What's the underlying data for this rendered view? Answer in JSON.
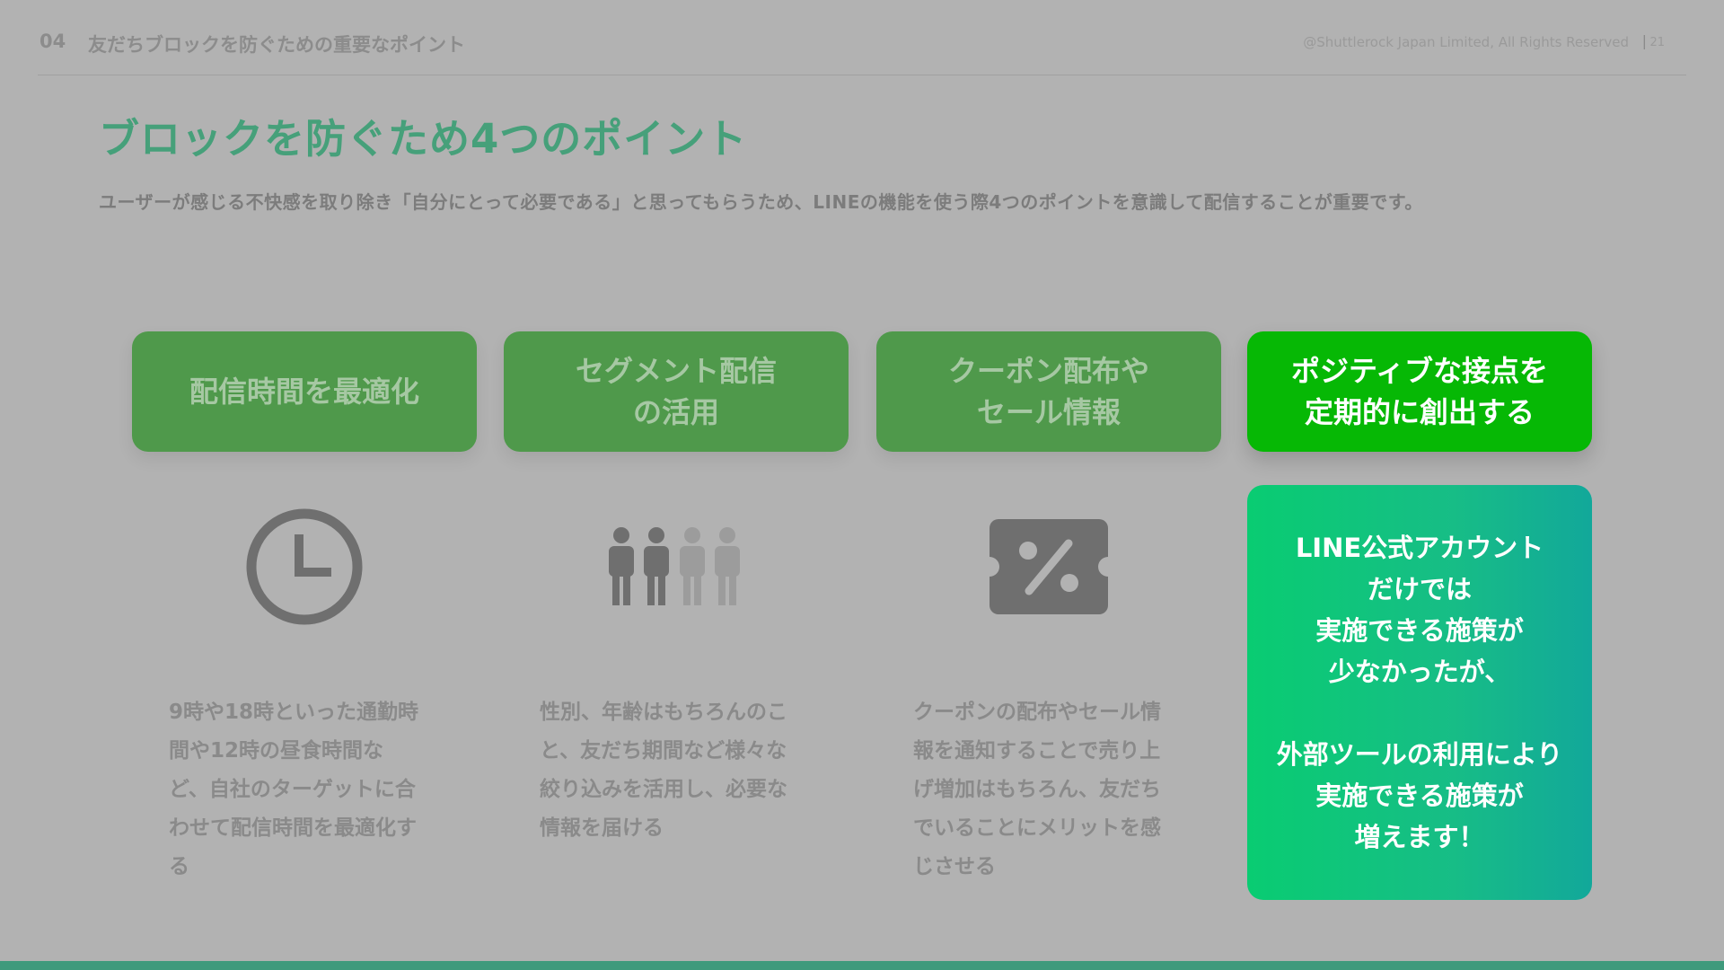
{
  "header": {
    "section_number": "04",
    "section_title": "友だちブロックを防ぐための重要なポイント",
    "copyright": "@Shuttlerock Japan Limited, All Rights Reserved",
    "separator": "|",
    "page_number": "21"
  },
  "title": "ブロックを防ぐため4つのポイント",
  "subtitle": "ユーザーが感じる不快感を取り除き「自分にとって必要である」と思ってもらうため、LINEの機能を使う際4つのポイントを意識して配信することが重要です。",
  "points": [
    {
      "heading": "配信時間を最適化",
      "icon": "clock-icon",
      "description": "9時や18時といった通勤時\n間や12時の昼食時間な\nど、自社のターゲットに合\nわせて配信時間を最適化す\nる"
    },
    {
      "heading": "セグメント配信\nの活用",
      "icon": "people-segment-icon",
      "description": "性別、年齢はもちろんのこ\nと、友だち期間など様々な\n絞り込みを活用し、必要な\n情報を届ける"
    },
    {
      "heading": "クーポン配布や\nセール情報",
      "icon": "coupon-percent-icon",
      "description": "クーポンの配布やセール情\n報を通知することで売り上\nげ増加はもちろん、友だち\nでいることにメリットを感\nじさせる"
    },
    {
      "heading": "ポジティブな接点を\n定期的に創出する",
      "highlight_part1": "LINE公式アカウント\nだけでは\n実施できる施策が\n少なかったが、",
      "highlight_part2": "外部ツールの利用により\n実施できる施策が\n増えます！"
    }
  ],
  "colors": {
    "background": "#b2b2b2",
    "title_green": "#46a07a",
    "card_green": "#4f994b",
    "active_green": "#06b805",
    "highlight_gradient_start": "#09cc72",
    "highlight_gradient_end": "#12a89a",
    "footer_bar": "#3f9a7c"
  }
}
